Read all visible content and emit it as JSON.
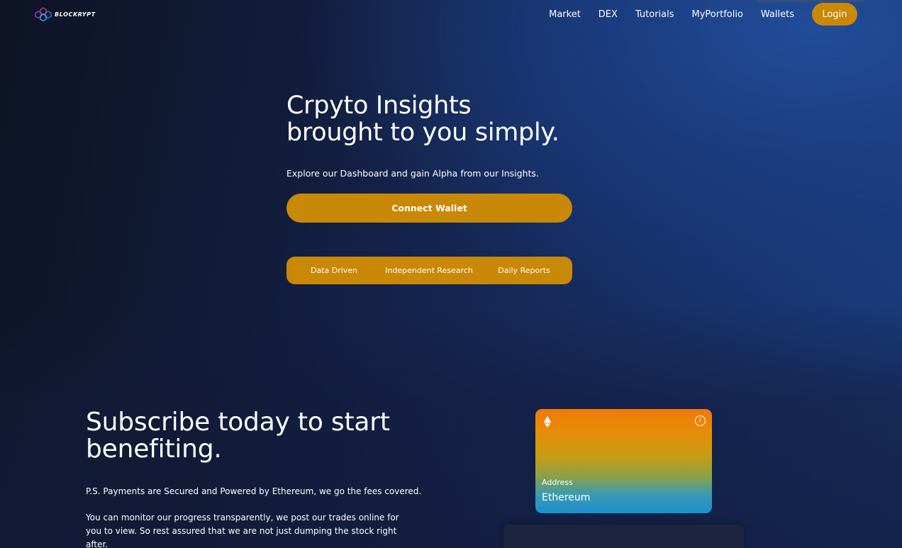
{
  "brand": {
    "name": "BLOCKRYPT",
    "logo_icon": "hexagon-network-icon"
  },
  "nav": {
    "links": [
      "Market",
      "DEX",
      "Tutorials",
      "MyPortfolio",
      "Wallets"
    ],
    "login_label": "Login"
  },
  "hero": {
    "title_line1": "Crpyto Insights",
    "title_line2": "brought to you simply.",
    "subtitle": "Explore our Dashboard and gain Alpha from our Insights.",
    "connect_label": "Connect Wallet",
    "features": [
      "Data Driven",
      "Independent Research",
      "Daily Reports"
    ]
  },
  "subscribe": {
    "title_line1": "Subscribe today to start",
    "title_line2": "benefiting.",
    "p1": "P.S. Payments are Secured and Powered by Ethereum, we go the fees covered.",
    "p2": "You can monitor our progress transparently, we post our trades online for you to view. So rest assured that we are not just dumping the stock right after."
  },
  "card": {
    "icon": "ethereum-icon",
    "info_icon": "info-icon",
    "label": "Address",
    "value": "Ethereum"
  },
  "colors": {
    "accent": "#c98806",
    "background_dark": "#0e1425",
    "background_blue": "#1a3b7c",
    "card_top": "#ef7a0a",
    "card_bottom": "#1c8fce"
  }
}
